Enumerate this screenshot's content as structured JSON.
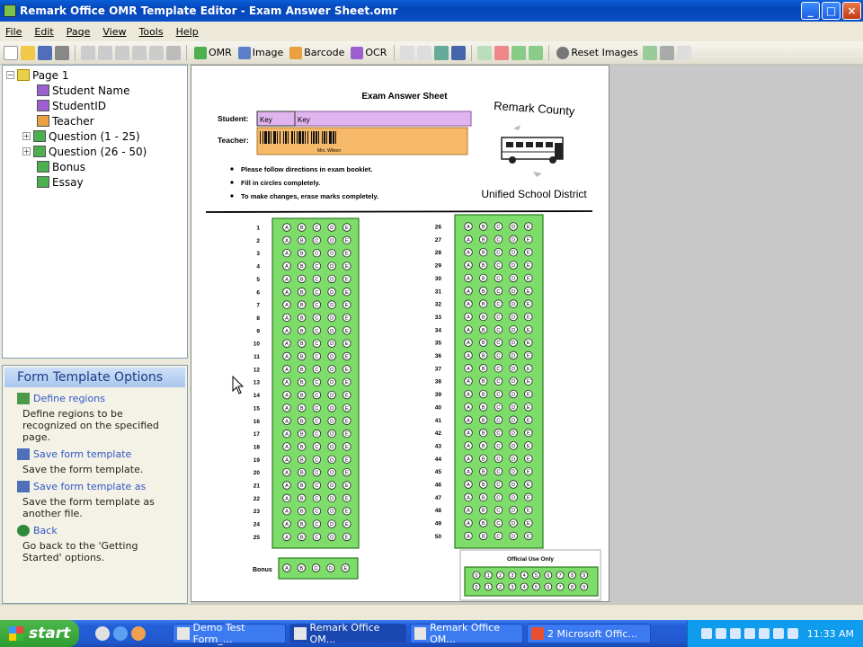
{
  "window": {
    "title": "Remark Office OMR Template Editor - Exam Answer Sheet.omr"
  },
  "menu": [
    "File",
    "Edit",
    "Page",
    "View",
    "Tools",
    "Help"
  ],
  "toolbar": {
    "omr": "OMR",
    "image": "Image",
    "barcode": "Barcode",
    "ocr": "OCR",
    "reset": "Reset Images"
  },
  "tree": {
    "root": "Page 1",
    "items": [
      {
        "label": "Student Name",
        "expandable": false,
        "color": "#9b5fd0"
      },
      {
        "label": "StudentID",
        "expandable": false,
        "color": "#9b5fd0"
      },
      {
        "label": "Teacher",
        "expandable": false,
        "color": "#e8a040"
      },
      {
        "label": "Question (1 - 25)",
        "expandable": true,
        "color": "#4caf50"
      },
      {
        "label": "Question (26 - 50)",
        "expandable": true,
        "color": "#4caf50"
      },
      {
        "label": "Bonus",
        "expandable": false,
        "color": "#4caf50"
      },
      {
        "label": "Essay",
        "expandable": false,
        "color": "#4caf50"
      }
    ]
  },
  "panel": {
    "title": "Form Template Options",
    "options": [
      {
        "label": "Define regions",
        "desc": "Define regions to be recognized on the specified page.",
        "icon": "define-regions-icon"
      },
      {
        "label": "Save form template",
        "desc": "Save the form template.",
        "icon": "save-icon"
      },
      {
        "label": "Save form template as",
        "desc": "Save the form template as another file.",
        "icon": "save-as-icon"
      },
      {
        "label": "Back",
        "desc": "Go back to the 'Getting Started' options.",
        "icon": "back-icon"
      }
    ]
  },
  "sheet": {
    "title": "Exam Answer Sheet",
    "student_label": "Student:",
    "student_key1": "Key",
    "student_key2": "Key",
    "teacher_label": "Teacher:",
    "teacher_caption": "Mrs. Wilson",
    "instructions": [
      "Please follow directions in exam booklet.",
      "Fill in circles completely.",
      "To make changes, erase marks completely."
    ],
    "school_top": "Remark County",
    "school_bottom": "Unified School District",
    "choices": [
      "A",
      "B",
      "C",
      "D",
      "E"
    ],
    "bonus_label": "Bonus",
    "official": "Official Use Only",
    "q_start_left": 1,
    "q_start_right": 26,
    "q_count": 25
  },
  "taskbar": {
    "start": "start",
    "tasks": [
      "Demo Test Form_...",
      "Remark Office OM...",
      "Remark Office OM...",
      "2 Microsoft Offic..."
    ],
    "clock": "11:33 AM"
  },
  "colors": {
    "region_green": "#7ddc6a",
    "region_purple": "#e0b4ee",
    "region_orange": "#f6b96a"
  }
}
